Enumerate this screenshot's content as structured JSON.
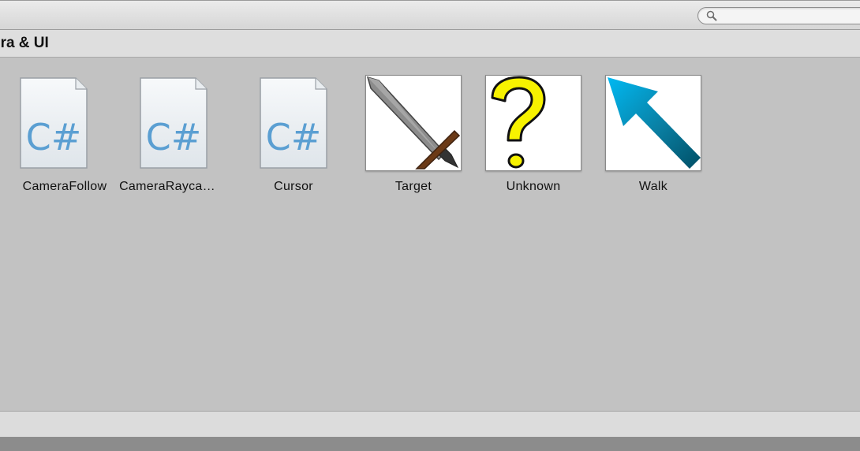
{
  "search": {
    "placeholder": "",
    "value": ""
  },
  "breadcrumb": {
    "label": "era & UI"
  },
  "items": [
    {
      "name": "CameraFollow",
      "type": "csharp-script"
    },
    {
      "name": "CameraRayca…",
      "type": "csharp-script"
    },
    {
      "name": "Cursor",
      "type": "csharp-script"
    },
    {
      "name": "Target",
      "type": "texture",
      "icon": "sword-icon"
    },
    {
      "name": "Unknown",
      "type": "texture",
      "icon": "question-mark-icon"
    },
    {
      "name": "Walk",
      "type": "texture",
      "icon": "arrow-icon"
    }
  ],
  "colors": {
    "csharp_text": "#5b9fd2",
    "sword_blade": "#8c8c8c",
    "sword_hilt": "#6b3a17",
    "question_mark": "#f7f200",
    "arrow_tip": "#00b4ec",
    "arrow_shaft": "#005a76"
  }
}
